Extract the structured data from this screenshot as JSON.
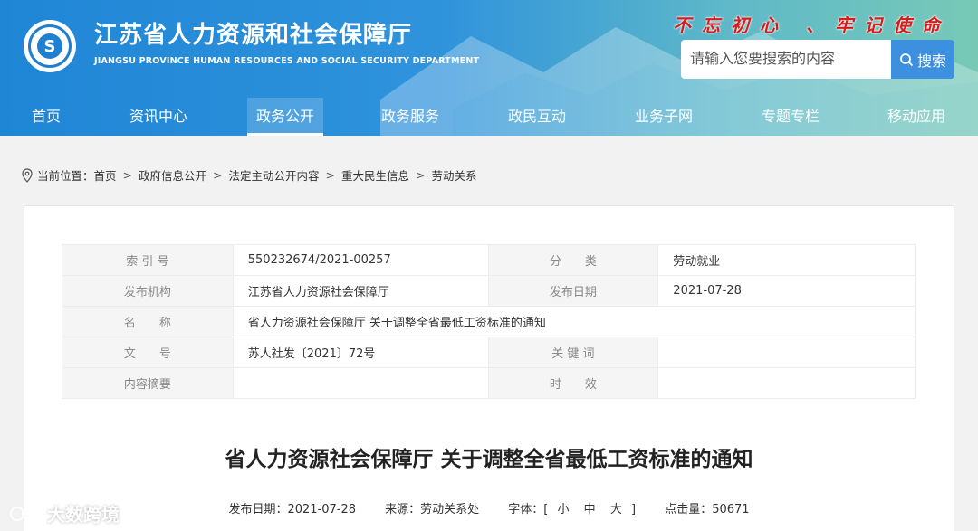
{
  "header": {
    "title": "江苏省人力资源和社会保障厅",
    "subtitle": "JIANGSU PROVINCE HUMAN RESOURCES AND SOCIAL SECURITY DEPARTMENT",
    "slogan": "不忘初心 、牢记使命",
    "logo_icon": "provincial-emblem-icon"
  },
  "search": {
    "placeholder": "请输入您要搜索的内容",
    "button_label": "搜索",
    "button_color": "#3d8fe0"
  },
  "nav": {
    "items": [
      {
        "label": "首页"
      },
      {
        "label": "资讯中心"
      },
      {
        "label": "政务公开"
      },
      {
        "label": "政务服务"
      },
      {
        "label": "政民互动"
      },
      {
        "label": "业务子网"
      },
      {
        "label": "专题专栏"
      },
      {
        "label": "移动应用"
      }
    ],
    "active_index": 2
  },
  "breadcrumb": {
    "prefix": "当前位置：",
    "items": [
      "首页",
      "政府信息公开",
      "法定主动公开内容",
      "重大民生信息",
      "劳动关系"
    ],
    "separator": ">"
  },
  "meta": {
    "index_label": "索 引 号",
    "index_value": "550232674/2021-00257",
    "category_label": "分　　类",
    "category_value": "劳动就业",
    "publisher_label": "发布机构",
    "publisher_value": "江苏省人力资源社会保障厅",
    "date_label": "发布日期",
    "date_value": "2021-07-28",
    "name_label": "名　　称",
    "name_value": "省人力资源社会保障厅 关于调整全省最低工资标准的通知",
    "docno_label": "文　　号",
    "docno_value": "苏人社发〔2021〕72号",
    "keywords_label": "关 键 词",
    "keywords_value": "",
    "abstract_label": "内容摘要",
    "abstract_value": "",
    "validity_label": "时　　效",
    "validity_value": ""
  },
  "document": {
    "title": "省人力资源社会保障厅 关于调整全省最低工资标准的通知",
    "publish_date": "发布日期：2021-07-28",
    "source": "来源：劳动关系处",
    "font_label": "字体：[",
    "font_small": "小",
    "font_medium": "中",
    "font_large": "大",
    "font_close": "]",
    "clicks": "点击量：50671"
  },
  "watermark": {
    "text": "大数跨境"
  }
}
